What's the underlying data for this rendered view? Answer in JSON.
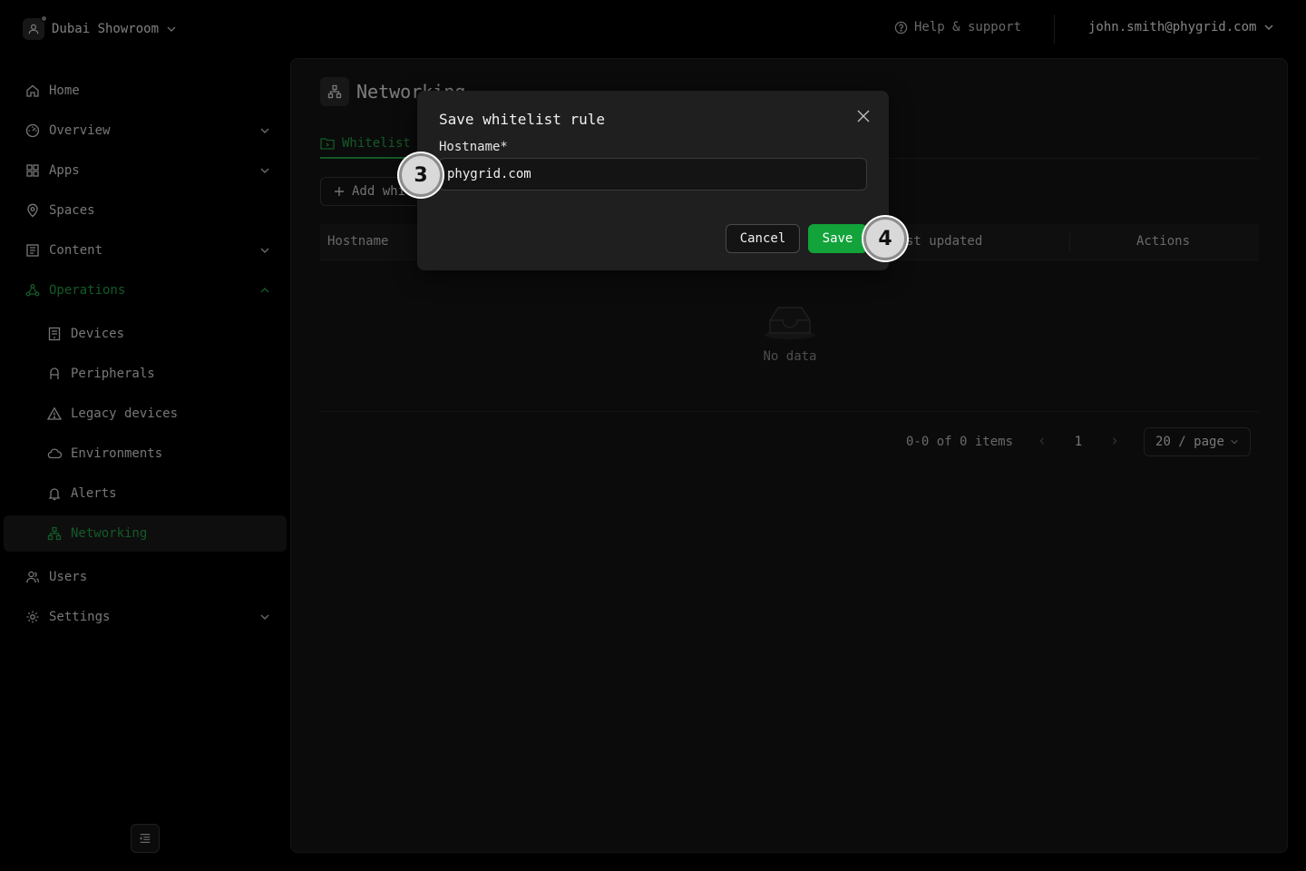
{
  "header": {
    "org_name": "Dubai Showroom",
    "help_label": "Help & support",
    "user_email": "john.smith@phygrid.com"
  },
  "sidebar": {
    "items": [
      {
        "label": "Home",
        "icon": "home-icon"
      },
      {
        "label": "Overview",
        "icon": "dashboard-icon"
      },
      {
        "label": "Apps",
        "icon": "apps-grid-icon"
      },
      {
        "label": "Spaces",
        "icon": "map-pin-icon"
      },
      {
        "label": "Content",
        "icon": "content-icon"
      },
      {
        "label": "Operations",
        "icon": "operations-icon"
      },
      {
        "label": "Devices",
        "icon": "device-icon"
      },
      {
        "label": "Peripherals",
        "icon": "peripheral-icon"
      },
      {
        "label": "Legacy devices",
        "icon": "warning-icon"
      },
      {
        "label": "Environments",
        "icon": "cloud-icon"
      },
      {
        "label": "Alerts",
        "icon": "bell-icon"
      },
      {
        "label": "Networking",
        "icon": "network-icon"
      },
      {
        "label": "Users",
        "icon": "users-icon"
      },
      {
        "label": "Settings",
        "icon": "settings-icon"
      }
    ],
    "accent_color": "#23a348"
  },
  "page": {
    "title": "Networking",
    "tab_label": "Whitelist",
    "add_button_label": "Add whi",
    "columns": {
      "hostname": "Hostname",
      "updated": "st updated",
      "actions": "Actions"
    },
    "empty_text": "No data",
    "pagination": {
      "count_text": "0-0 of 0 items",
      "page": "1",
      "page_size": "20 / page"
    }
  },
  "modal": {
    "title": "Save whitelist rule",
    "field_label": "Hostname*",
    "hostname_value": "phygrid.com",
    "cancel_label": "Cancel",
    "save_label": "Save",
    "save_color": "#12a33a"
  },
  "steps": {
    "input_step": "3",
    "save_step": "4"
  }
}
